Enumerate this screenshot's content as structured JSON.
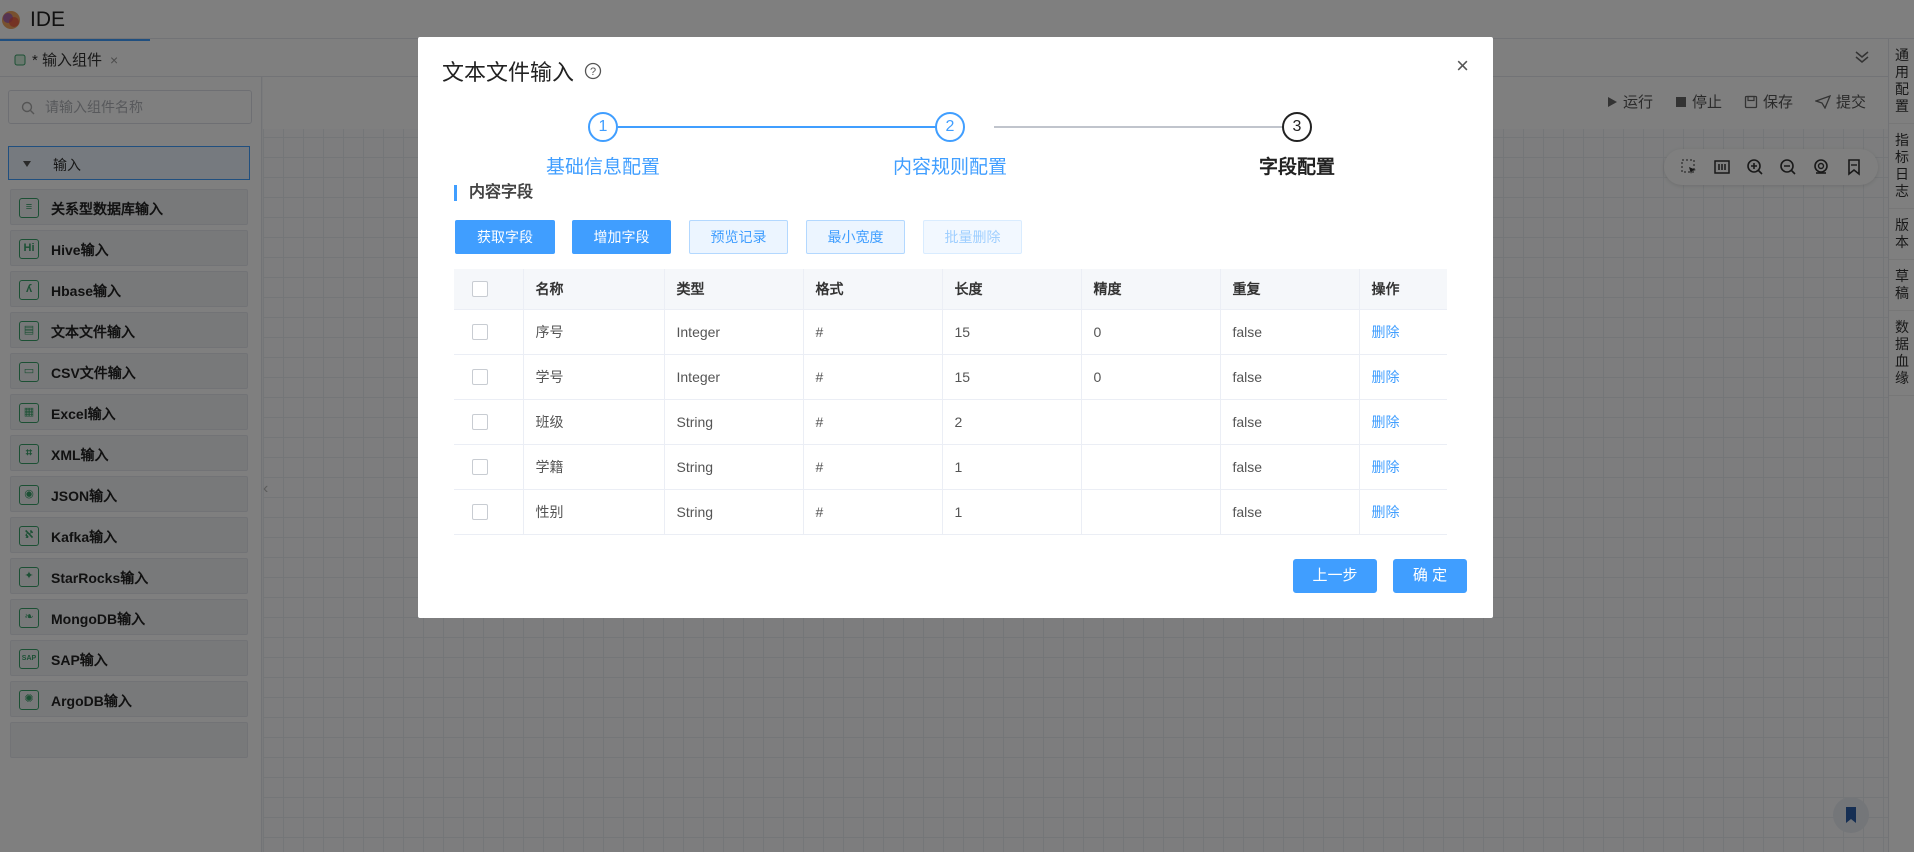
{
  "app": {
    "title": "IDE",
    "logo_icon": "flower-logo-icon"
  },
  "tabs": [
    {
      "label": "* 输入组件",
      "close": "×"
    }
  ],
  "sidebar": {
    "search_placeholder": "请输入组件名称",
    "group_label": "输入",
    "items": [
      {
        "label": "关系型数据库输入",
        "icon": "database-icon",
        "glyph": "≡"
      },
      {
        "label": "Hive输入",
        "icon": "hive-icon",
        "glyph": "Hi"
      },
      {
        "label": "Hbase输入",
        "icon": "hbase-icon",
        "glyph": "ʎ"
      },
      {
        "label": "文本文件输入",
        "icon": "text-file-icon",
        "glyph": "▤"
      },
      {
        "label": "CSV文件输入",
        "icon": "csv-file-icon",
        "glyph": "▭"
      },
      {
        "label": "Excel输入",
        "icon": "excel-icon",
        "glyph": "▦"
      },
      {
        "label": "XML输入",
        "icon": "xml-icon",
        "glyph": "⌗"
      },
      {
        "label": "JSON输入",
        "icon": "json-icon",
        "glyph": "◉"
      },
      {
        "label": "Kafka输入",
        "icon": "kafka-icon",
        "glyph": "ℵ"
      },
      {
        "label": "StarRocks输入",
        "icon": "starrocks-icon",
        "glyph": "✦"
      },
      {
        "label": "MongoDB输入",
        "icon": "mongodb-icon",
        "glyph": "❧"
      },
      {
        "label": "SAP输入",
        "icon": "sap-icon",
        "glyph": "SAP"
      },
      {
        "label": "ArgoDB输入",
        "icon": "argodb-icon",
        "glyph": "✺"
      }
    ]
  },
  "toolbar": {
    "run": "运行",
    "stop": "停止",
    "save": "保存",
    "submit": "提交"
  },
  "rightbar": [
    "通用配置",
    "指标日志",
    "版本",
    "草稿",
    "数据血缘"
  ],
  "modal": {
    "title": "文本文件输入",
    "close": "×",
    "steps": [
      {
        "num": "1",
        "label": "基础信息配置"
      },
      {
        "num": "2",
        "label": "内容规则配置"
      },
      {
        "num": "3",
        "label": "字段配置"
      }
    ],
    "section_title": "内容字段",
    "buttons": {
      "fetch": "获取字段",
      "add": "增加字段",
      "preview": "预览记录",
      "min_width": "最小宽度",
      "batch_delete": "批量删除"
    },
    "table": {
      "headers": [
        "名称",
        "类型",
        "格式",
        "长度",
        "精度",
        "重复",
        "操作"
      ],
      "rows": [
        {
          "name": "序号",
          "type": "Integer",
          "format": "#",
          "length": "15",
          "precision": "0",
          "repeat": "false",
          "action": "删除"
        },
        {
          "name": "学号",
          "type": "Integer",
          "format": "#",
          "length": "15",
          "precision": "0",
          "repeat": "false",
          "action": "删除"
        },
        {
          "name": "班级",
          "type": "String",
          "format": "#",
          "length": "2",
          "precision": "",
          "repeat": "false",
          "action": "删除"
        },
        {
          "name": "学籍",
          "type": "String",
          "format": "#",
          "length": "1",
          "precision": "",
          "repeat": "false",
          "action": "删除"
        },
        {
          "name": "性别",
          "type": "String",
          "format": "#",
          "length": "1",
          "precision": "",
          "repeat": "false",
          "action": "删除"
        }
      ]
    },
    "footer": {
      "prev": "上一步",
      "confirm": "确 定"
    }
  },
  "colors": {
    "primary": "#409eff",
    "green": "#38a169",
    "mask": "rgba(0,0,0,0.5)"
  }
}
